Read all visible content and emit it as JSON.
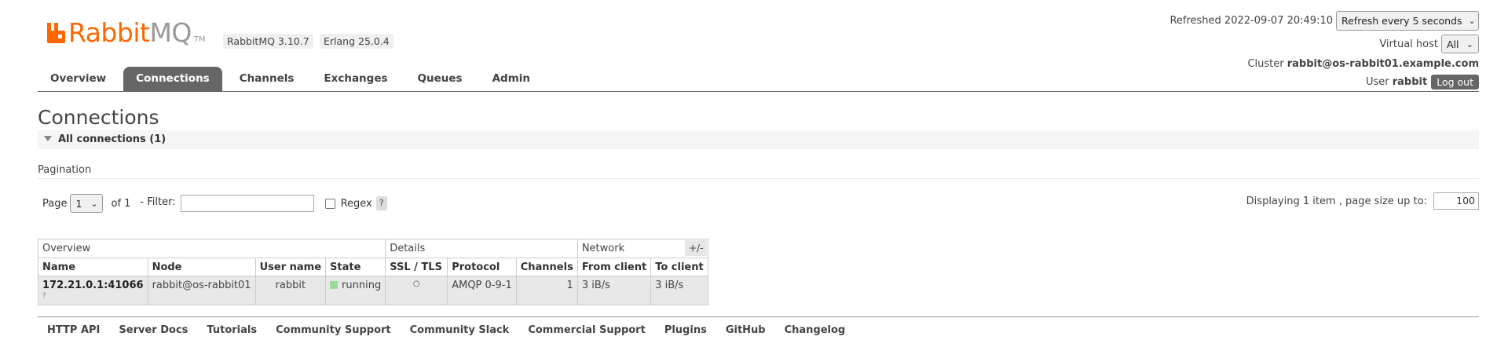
{
  "header": {
    "logo_rabbit": "Rabbit",
    "logo_mq": "MQ",
    "logo_tm": "TM",
    "rabbitmq_version": "RabbitMQ 3.10.7",
    "erlang_version": "Erlang 25.0.4",
    "refreshed_text": "Refreshed 2022-09-07 20:49:10",
    "refresh_select": "Refresh every 5 seconds",
    "virtual_host_label": "Virtual host",
    "virtual_host_select": "All",
    "cluster_label": "Cluster",
    "cluster_name": "rabbit@os-rabbit01.example.com",
    "user_label": "User",
    "user_name": "rabbit",
    "logout_label": "Log out"
  },
  "tabs": [
    {
      "label": "Overview"
    },
    {
      "label": "Connections",
      "active": true
    },
    {
      "label": "Channels"
    },
    {
      "label": "Exchanges"
    },
    {
      "label": "Queues"
    },
    {
      "label": "Admin"
    }
  ],
  "page_title": "Connections",
  "section": {
    "label": "All connections (1)"
  },
  "pagination": {
    "label": "Pagination",
    "page_label": "Page",
    "page_value": "1",
    "of_label": "of 1",
    "filter_label": "- Filter:",
    "filter_value": "",
    "regex_label": "Regex",
    "help": "?",
    "display_text": "Displaying 1 item , page size up to:",
    "page_size": "100"
  },
  "table": {
    "groups": [
      "Overview",
      "Details",
      "Network"
    ],
    "plus_minus": "+/-",
    "columns": [
      "Name",
      "Node",
      "User name",
      "State",
      "SSL / TLS",
      "Protocol",
      "Channels",
      "From client",
      "To client"
    ],
    "rows": [
      {
        "name": "172.21.0.1:41066",
        "name_sub": "?",
        "node": "rabbit@os-rabbit01",
        "user": "rabbit",
        "state": "running",
        "ssl": "○",
        "protocol": "AMQP 0-9-1",
        "channels": "1",
        "from_client": "3 iB/s",
        "to_client": "3 iB/s"
      }
    ],
    "state_color": "#99dd99"
  },
  "footer": [
    "HTTP API",
    "Server Docs",
    "Tutorials",
    "Community Support",
    "Community Slack",
    "Commercial Support",
    "Plugins",
    "GitHub",
    "Changelog"
  ],
  "colors": {
    "brand_orange": "#ff6600",
    "tab_active": "#666666"
  }
}
